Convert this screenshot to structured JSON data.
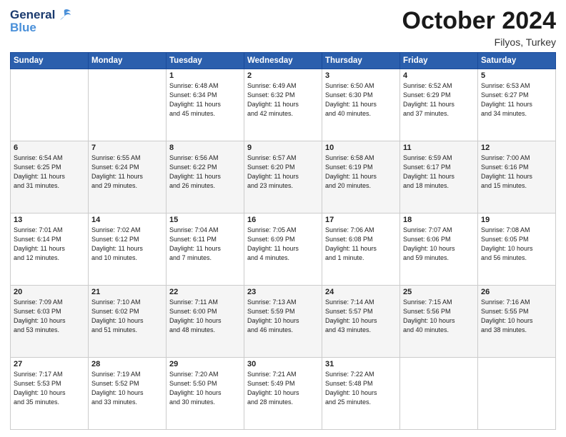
{
  "logo": {
    "line1": "General",
    "line2": "Blue"
  },
  "title": "October 2024",
  "location": "Filyos, Turkey",
  "days_header": [
    "Sunday",
    "Monday",
    "Tuesday",
    "Wednesday",
    "Thursday",
    "Friday",
    "Saturday"
  ],
  "weeks": [
    [
      {
        "day": "",
        "info": ""
      },
      {
        "day": "",
        "info": ""
      },
      {
        "day": "1",
        "info": "Sunrise: 6:48 AM\nSunset: 6:34 PM\nDaylight: 11 hours\nand 45 minutes."
      },
      {
        "day": "2",
        "info": "Sunrise: 6:49 AM\nSunset: 6:32 PM\nDaylight: 11 hours\nand 42 minutes."
      },
      {
        "day": "3",
        "info": "Sunrise: 6:50 AM\nSunset: 6:30 PM\nDaylight: 11 hours\nand 40 minutes."
      },
      {
        "day": "4",
        "info": "Sunrise: 6:52 AM\nSunset: 6:29 PM\nDaylight: 11 hours\nand 37 minutes."
      },
      {
        "day": "5",
        "info": "Sunrise: 6:53 AM\nSunset: 6:27 PM\nDaylight: 11 hours\nand 34 minutes."
      }
    ],
    [
      {
        "day": "6",
        "info": "Sunrise: 6:54 AM\nSunset: 6:25 PM\nDaylight: 11 hours\nand 31 minutes."
      },
      {
        "day": "7",
        "info": "Sunrise: 6:55 AM\nSunset: 6:24 PM\nDaylight: 11 hours\nand 29 minutes."
      },
      {
        "day": "8",
        "info": "Sunrise: 6:56 AM\nSunset: 6:22 PM\nDaylight: 11 hours\nand 26 minutes."
      },
      {
        "day": "9",
        "info": "Sunrise: 6:57 AM\nSunset: 6:20 PM\nDaylight: 11 hours\nand 23 minutes."
      },
      {
        "day": "10",
        "info": "Sunrise: 6:58 AM\nSunset: 6:19 PM\nDaylight: 11 hours\nand 20 minutes."
      },
      {
        "day": "11",
        "info": "Sunrise: 6:59 AM\nSunset: 6:17 PM\nDaylight: 11 hours\nand 18 minutes."
      },
      {
        "day": "12",
        "info": "Sunrise: 7:00 AM\nSunset: 6:16 PM\nDaylight: 11 hours\nand 15 minutes."
      }
    ],
    [
      {
        "day": "13",
        "info": "Sunrise: 7:01 AM\nSunset: 6:14 PM\nDaylight: 11 hours\nand 12 minutes."
      },
      {
        "day": "14",
        "info": "Sunrise: 7:02 AM\nSunset: 6:12 PM\nDaylight: 11 hours\nand 10 minutes."
      },
      {
        "day": "15",
        "info": "Sunrise: 7:04 AM\nSunset: 6:11 PM\nDaylight: 11 hours\nand 7 minutes."
      },
      {
        "day": "16",
        "info": "Sunrise: 7:05 AM\nSunset: 6:09 PM\nDaylight: 11 hours\nand 4 minutes."
      },
      {
        "day": "17",
        "info": "Sunrise: 7:06 AM\nSunset: 6:08 PM\nDaylight: 11 hours\nand 1 minute."
      },
      {
        "day": "18",
        "info": "Sunrise: 7:07 AM\nSunset: 6:06 PM\nDaylight: 10 hours\nand 59 minutes."
      },
      {
        "day": "19",
        "info": "Sunrise: 7:08 AM\nSunset: 6:05 PM\nDaylight: 10 hours\nand 56 minutes."
      }
    ],
    [
      {
        "day": "20",
        "info": "Sunrise: 7:09 AM\nSunset: 6:03 PM\nDaylight: 10 hours\nand 53 minutes."
      },
      {
        "day": "21",
        "info": "Sunrise: 7:10 AM\nSunset: 6:02 PM\nDaylight: 10 hours\nand 51 minutes."
      },
      {
        "day": "22",
        "info": "Sunrise: 7:11 AM\nSunset: 6:00 PM\nDaylight: 10 hours\nand 48 minutes."
      },
      {
        "day": "23",
        "info": "Sunrise: 7:13 AM\nSunset: 5:59 PM\nDaylight: 10 hours\nand 46 minutes."
      },
      {
        "day": "24",
        "info": "Sunrise: 7:14 AM\nSunset: 5:57 PM\nDaylight: 10 hours\nand 43 minutes."
      },
      {
        "day": "25",
        "info": "Sunrise: 7:15 AM\nSunset: 5:56 PM\nDaylight: 10 hours\nand 40 minutes."
      },
      {
        "day": "26",
        "info": "Sunrise: 7:16 AM\nSunset: 5:55 PM\nDaylight: 10 hours\nand 38 minutes."
      }
    ],
    [
      {
        "day": "27",
        "info": "Sunrise: 7:17 AM\nSunset: 5:53 PM\nDaylight: 10 hours\nand 35 minutes."
      },
      {
        "day": "28",
        "info": "Sunrise: 7:19 AM\nSunset: 5:52 PM\nDaylight: 10 hours\nand 33 minutes."
      },
      {
        "day": "29",
        "info": "Sunrise: 7:20 AM\nSunset: 5:50 PM\nDaylight: 10 hours\nand 30 minutes."
      },
      {
        "day": "30",
        "info": "Sunrise: 7:21 AM\nSunset: 5:49 PM\nDaylight: 10 hours\nand 28 minutes."
      },
      {
        "day": "31",
        "info": "Sunrise: 7:22 AM\nSunset: 5:48 PM\nDaylight: 10 hours\nand 25 minutes."
      },
      {
        "day": "",
        "info": ""
      },
      {
        "day": "",
        "info": ""
      }
    ]
  ]
}
